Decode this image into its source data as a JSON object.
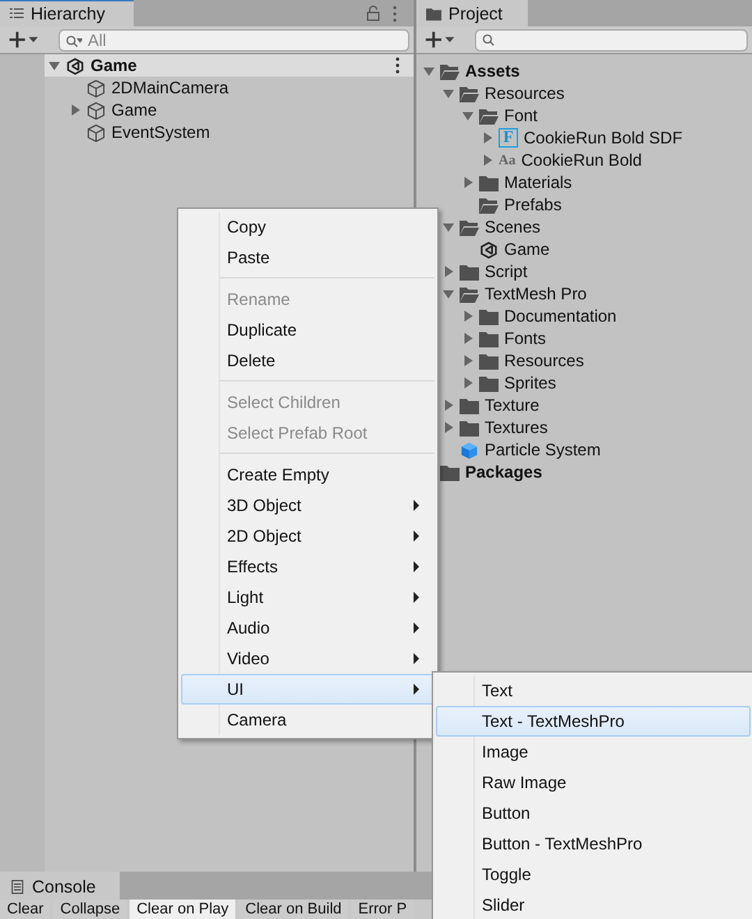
{
  "hierarchy": {
    "tab": "Hierarchy",
    "search": {
      "placeholder": "All"
    },
    "tree": [
      {
        "label": "Game",
        "kind": "scene",
        "bold": true,
        "expanded": true,
        "selected": true,
        "children": [
          {
            "label": "2DMainCamera",
            "kind": "gameobject",
            "selected": false
          },
          {
            "label": "Game",
            "kind": "gameobject",
            "expanded": false,
            "selected": false
          },
          {
            "label": "EventSystem",
            "kind": "gameobject",
            "selected": false
          }
        ]
      }
    ]
  },
  "project": {
    "tab": "Project",
    "tree": [
      {
        "label": "Assets",
        "kind": "folder_open",
        "bold": true,
        "expanded": true,
        "children": [
          {
            "label": "Resources",
            "kind": "folder_open",
            "expanded": true,
            "children": [
              {
                "label": "Font",
                "kind": "folder_open",
                "expanded": true,
                "children": [
                  {
                    "label": "CookieRun Bold SDF",
                    "kind": "font_asset",
                    "badge": "F",
                    "expanded": false
                  },
                  {
                    "label": "CookieRun Bold",
                    "kind": "font",
                    "badge": "Aa",
                    "expanded": false
                  }
                ]
              },
              {
                "label": "Materials",
                "kind": "folder",
                "expanded": false
              },
              {
                "label": "Prefabs",
                "kind": "folder_open"
              }
            ]
          },
          {
            "label": "Scenes",
            "kind": "folder_open",
            "expanded": true,
            "children": [
              {
                "label": "Game",
                "kind": "scene"
              }
            ]
          },
          {
            "label": "Script",
            "kind": "folder",
            "expanded": false
          },
          {
            "label": "TextMesh Pro",
            "kind": "folder_open",
            "expanded": true,
            "children": [
              {
                "label": "Documentation",
                "kind": "folder",
                "expanded": false
              },
              {
                "label": "Fonts",
                "kind": "folder",
                "expanded": false
              },
              {
                "label": "Resources",
                "kind": "folder",
                "expanded": false
              },
              {
                "label": "Sprites",
                "kind": "folder",
                "expanded": false
              }
            ]
          },
          {
            "label": "Texture",
            "kind": "folder",
            "expanded": false
          },
          {
            "label": "Textures",
            "kind": "folder",
            "expanded": false
          },
          {
            "label": "Particle System",
            "kind": "prefab"
          }
        ]
      },
      {
        "label": "Packages",
        "kind": "folder",
        "bold": true
      }
    ]
  },
  "console": {
    "tab": "Console",
    "buttons": [
      {
        "label": "Clear",
        "selected": false
      },
      {
        "label": "Collapse",
        "selected": false
      },
      {
        "label": "Clear on Play",
        "selected": true
      },
      {
        "label": "Clear on Build",
        "selected": false
      },
      {
        "label": "Error P",
        "selected": false
      }
    ]
  },
  "context_menu": {
    "groups": [
      [
        {
          "label": "Copy",
          "disabled": false,
          "submenu": false,
          "selected": false
        },
        {
          "label": "Paste",
          "disabled": false,
          "submenu": false,
          "selected": false
        }
      ],
      [
        {
          "label": "Rename",
          "disabled": true,
          "submenu": false,
          "selected": false
        },
        {
          "label": "Duplicate",
          "disabled": false,
          "submenu": false,
          "selected": false
        },
        {
          "label": "Delete",
          "disabled": false,
          "submenu": false,
          "selected": false
        }
      ],
      [
        {
          "label": "Select Children",
          "disabled": true,
          "submenu": false,
          "selected": false
        },
        {
          "label": "Select Prefab Root",
          "disabled": true,
          "submenu": false,
          "selected": false
        }
      ],
      [
        {
          "label": "Create Empty",
          "disabled": false,
          "submenu": false,
          "selected": false
        },
        {
          "label": "3D Object",
          "disabled": false,
          "submenu": true,
          "selected": false
        },
        {
          "label": "2D Object",
          "disabled": false,
          "submenu": true,
          "selected": false
        },
        {
          "label": "Effects",
          "disabled": false,
          "submenu": true,
          "selected": false
        },
        {
          "label": "Light",
          "disabled": false,
          "submenu": true,
          "selected": false
        },
        {
          "label": "Audio",
          "disabled": false,
          "submenu": true,
          "selected": false
        },
        {
          "label": "Video",
          "disabled": false,
          "submenu": true,
          "selected": false
        },
        {
          "label": "UI",
          "disabled": false,
          "submenu": true,
          "selected": true
        },
        {
          "label": "Camera",
          "disabled": false,
          "submenu": false,
          "selected": false
        }
      ]
    ]
  },
  "submenu": {
    "items": [
      {
        "label": "Text",
        "selected": false
      },
      {
        "label": "Text - TextMeshPro",
        "selected": true
      },
      {
        "label": "Image",
        "selected": false
      },
      {
        "label": "Raw Image",
        "selected": false
      },
      {
        "label": "Button",
        "selected": false
      },
      {
        "label": "Button - TextMeshPro",
        "selected": false
      },
      {
        "label": "Toggle",
        "selected": false
      },
      {
        "label": "Slider",
        "selected": false
      }
    ]
  }
}
